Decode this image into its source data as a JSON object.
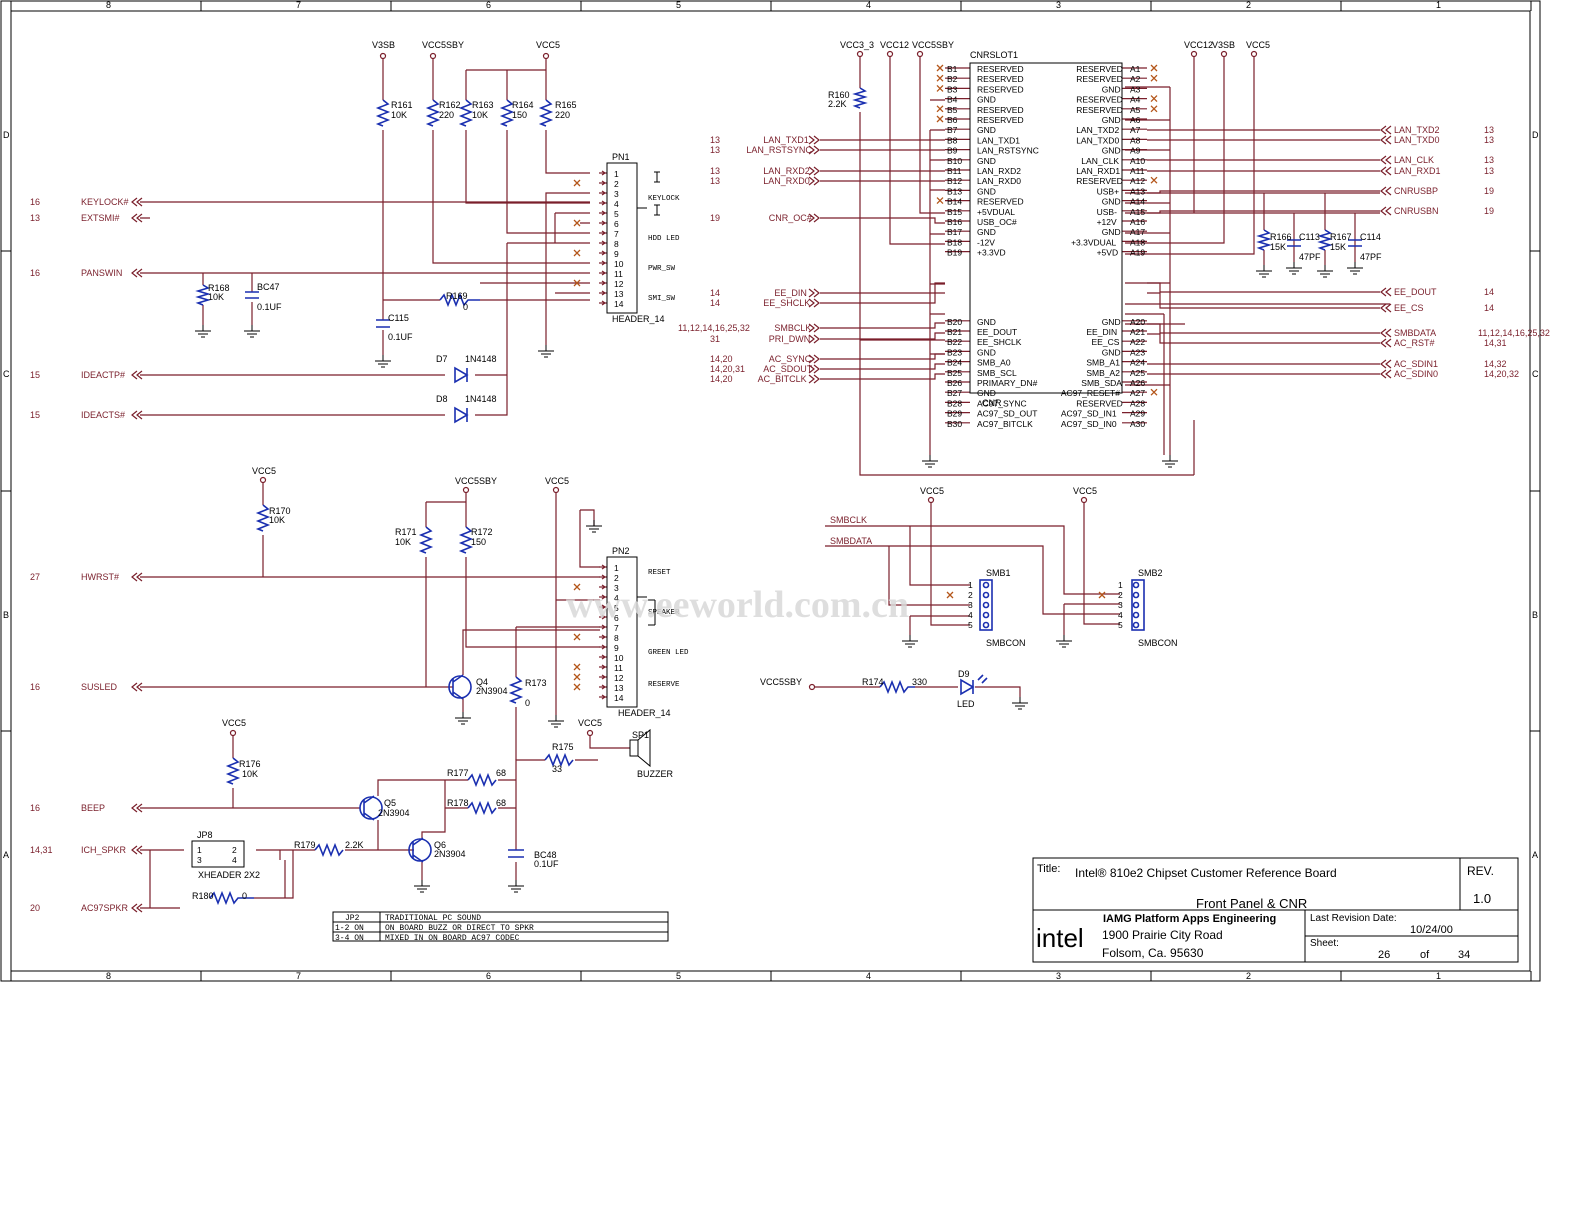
{
  "border": {
    "columns": [
      "8",
      "7",
      "6",
      "5",
      "4",
      "3",
      "2",
      "1"
    ],
    "rows": [
      "D",
      "C",
      "B",
      "A"
    ]
  },
  "supplies": {
    "v3sb": "V3SB",
    "vcc5sby": "VCC5SBY",
    "vcc5": "VCC5",
    "vcc3_3": "VCC3_3",
    "vcc12": "VCC12",
    "v3sb2": "V3SB"
  },
  "front_panel": {
    "pn1": {
      "ref": "PN1",
      "type": "HEADER_14",
      "pins": [
        "1",
        "2",
        "3",
        "4",
        "5",
        "6",
        "7",
        "8",
        "9",
        "10",
        "11",
        "12",
        "13",
        "14"
      ],
      "groups": [
        "KEYLOCK",
        "HDD LED",
        "PWR_SW",
        "SMI_SW"
      ]
    },
    "pn2": {
      "ref": "PN2",
      "type": "HEADER_14",
      "pins": [
        "1",
        "2",
        "3",
        "4",
        "5",
        "6",
        "7",
        "8",
        "9",
        "10",
        "11",
        "12",
        "13",
        "14"
      ],
      "groups": [
        "RESET",
        "SPEAKER",
        "GREEN LED",
        "RESERVE"
      ]
    },
    "signals": [
      {
        "page": "16",
        "name": "KEYLOCK#"
      },
      {
        "page": "13",
        "name": "EXTSMI#"
      },
      {
        "page": "16",
        "name": "PANSWIN"
      },
      {
        "page": "15",
        "name": "IDEACTP#"
      },
      {
        "page": "15",
        "name": "IDEACTS#"
      },
      {
        "page": "27",
        "name": "HWRST#"
      },
      {
        "page": "16",
        "name": "SUSLED"
      },
      {
        "page": "16",
        "name": "BEEP"
      },
      {
        "page": "14,31",
        "name": "ICH_SPKR"
      },
      {
        "page": "20",
        "name": "AC97SPKR"
      }
    ],
    "resistors": [
      {
        "ref": "R161",
        "value": "10K"
      },
      {
        "ref": "R162",
        "value": "220"
      },
      {
        "ref": "R163",
        "value": "10K"
      },
      {
        "ref": "R164",
        "value": "150"
      },
      {
        "ref": "R165",
        "value": "220"
      },
      {
        "ref": "R168",
        "value": "10K"
      },
      {
        "ref": "R169",
        "value": "0"
      },
      {
        "ref": "R170",
        "value": "10K"
      },
      {
        "ref": "R171",
        "value": "10K"
      },
      {
        "ref": "R172",
        "value": "150"
      },
      {
        "ref": "R173",
        "value": "0"
      },
      {
        "ref": "R175",
        "value": "33"
      },
      {
        "ref": "R176",
        "value": "10K"
      },
      {
        "ref": "R177",
        "value": "68"
      },
      {
        "ref": "R178",
        "value": "68"
      },
      {
        "ref": "R179",
        "value": "2.2K"
      },
      {
        "ref": "R180",
        "value": "0"
      },
      {
        "ref": "R174",
        "value": "330"
      }
    ],
    "caps": [
      {
        "ref": "BC47",
        "value": "0.1UF"
      },
      {
        "ref": "C115",
        "value": "0.1UF"
      },
      {
        "ref": "BC48",
        "value": "0.1UF"
      }
    ],
    "diodes": [
      {
        "ref": "D7",
        "value": "1N4148"
      },
      {
        "ref": "D8",
        "value": "1N4148"
      }
    ],
    "transistors": [
      {
        "ref": "Q4",
        "value": "2N3904"
      },
      {
        "ref": "Q5",
        "value": "2N3904"
      },
      {
        "ref": "Q6",
        "value": "2N3904"
      }
    ],
    "jp8": {
      "ref": "JP8",
      "type": "XHEADER 2X2",
      "pins": [
        "1",
        "2",
        "3",
        "4"
      ]
    },
    "speaker": {
      "ref": "SP1",
      "type": "BUZZER"
    },
    "led": {
      "ref": "D9",
      "type": "LED"
    }
  },
  "jp2_table": [
    [
      "JP2",
      "TRADITIONAL PC SOUND"
    ],
    [
      "1-2 ON",
      "ON BOARD BUZZ OR DIRECT TO SPKR"
    ],
    [
      "3-4 ON",
      "MIXED IN ON BOARD AC97 CODEC"
    ]
  ],
  "cnr": {
    "ref": "CNRSLOT1",
    "footer": "CNR",
    "r160": {
      "ref": "R160",
      "value": "2.2K"
    },
    "b_pins": [
      "B1",
      "B2",
      "B3",
      "B4",
      "B5",
      "B6",
      "B7",
      "B8",
      "B9",
      "B10",
      "B11",
      "B12",
      "B13",
      "B14",
      "B15",
      "B16",
      "B17",
      "B18",
      "B19",
      "B20",
      "B21",
      "B22",
      "B23",
      "B24",
      "B25",
      "B26",
      "B27",
      "B28",
      "B29",
      "B30"
    ],
    "b_names": [
      "RESERVED",
      "RESERVED",
      "RESERVED",
      "GND",
      "RESERVED",
      "RESERVED",
      "GND",
      "LAN_TXD1",
      "LAN_RSTSYNC",
      "GND",
      "LAN_RXD2",
      "LAN_RXD0",
      "GND",
      "RESERVED",
      "+5VDUAL",
      "USB_OC#",
      "GND",
      "-12V",
      "+3.3VD",
      "GND",
      "EE_DOUT",
      "EE_SHCLK",
      "GND",
      "SMB_A0",
      "SMB_SCL",
      "PRIMARY_DN#",
      "GND",
      "AC97_SYNC",
      "AC97_SD_OUT",
      "AC97_BITCLK"
    ],
    "a_pins": [
      "A1",
      "A2",
      "A3",
      "A4",
      "A5",
      "A6",
      "A7",
      "A8",
      "A9",
      "A10",
      "A11",
      "A12",
      "A13",
      "A14",
      "A15",
      "A16",
      "A17",
      "A18",
      "A19",
      "A20",
      "A21",
      "A22",
      "A23",
      "A24",
      "A25",
      "A26",
      "A27",
      "A28",
      "A29",
      "A30"
    ],
    "a_names": [
      "RESERVED",
      "RESERVED",
      "GND",
      "RESERVED",
      "RESERVED",
      "GND",
      "LAN_TXD2",
      "LAN_TXD0",
      "GND",
      "LAN_CLK",
      "LAN_RXD1",
      "RESERVED",
      "USB+",
      "GND",
      "USB-",
      "+12V",
      "GND",
      "+3.3VDUAL",
      "+5VD",
      "GND",
      "EE_DIN",
      "EE_CS",
      "GND",
      "SMB_A1",
      "SMB_A2",
      "SMB_SDA",
      "AC97_RESET#",
      "RESERVED",
      "AC97_SD_IN1",
      "AC97_SD_IN0"
    ],
    "left_signals": [
      {
        "page": "13",
        "name": "LAN_TXD1"
      },
      {
        "page": "13",
        "name": "LAN_RSTSYNC"
      },
      {
        "page": "13",
        "name": "LAN_RXD2"
      },
      {
        "page": "13",
        "name": "LAN_RXD0"
      },
      {
        "page": "19",
        "name": "CNR_OC#"
      },
      {
        "page": "14",
        "name": "EE_DIN"
      },
      {
        "page": "14",
        "name": "EE_SHCLK"
      },
      {
        "page": "11,12,14,16,25,32",
        "name": "SMBCLK"
      },
      {
        "page": "31",
        "name": "PRI_DWN"
      },
      {
        "page": "14,20",
        "name": "AC_SYNC"
      },
      {
        "page": "14,20,31",
        "name": "AC_SDOUT"
      },
      {
        "page": "14,20",
        "name": "AC_BITCLK"
      }
    ],
    "right_signals": [
      {
        "page": "13",
        "name": "LAN_TXD2"
      },
      {
        "page": "13",
        "name": "LAN_TXD0"
      },
      {
        "page": "13",
        "name": "LAN_CLK"
      },
      {
        "page": "13",
        "name": "LAN_RXD1"
      },
      {
        "page": "19",
        "name": "CNRUSBP"
      },
      {
        "page": "19",
        "name": "CNRUSBN"
      },
      {
        "page": "14",
        "name": "EE_DOUT"
      },
      {
        "page": "14",
        "name": "EE_CS"
      },
      {
        "page": "11,12,14,16,25,32",
        "name": "SMBDATA"
      },
      {
        "page": "14,31",
        "name": "AC_RST#"
      },
      {
        "page": "14,32",
        "name": "AC_SDIN1"
      },
      {
        "page": "14,20,32",
        "name": "AC_SDIN0"
      }
    ],
    "usb_parts": [
      {
        "ref": "R166",
        "value": "15K"
      },
      {
        "ref": "C113",
        "value": "47PF"
      },
      {
        "ref": "R167",
        "value": "15K"
      },
      {
        "ref": "C114",
        "value": "47PF"
      }
    ]
  },
  "smbus": {
    "signals": [
      "SMBCLK",
      "SMBDATA"
    ],
    "smb1": {
      "ref": "SMB1",
      "type": "SMBCON",
      "pins": [
        "1",
        "2",
        "3",
        "4",
        "5"
      ]
    },
    "smb2": {
      "ref": "SMB2",
      "type": "SMBCON",
      "pins": [
        "1",
        "2",
        "3",
        "4",
        "5"
      ]
    }
  },
  "watermark": "www.eeworld.com.cn",
  "title_block": {
    "title_label": "Title:",
    "title": "Intel® 810e2 Chipset Customer Reference Board",
    "subtitle": "Front Panel & CNR",
    "rev_label": "REV.",
    "rev": "1.0",
    "logo": "intel",
    "org": "IAMG Platform Apps Engineering",
    "addr1": "1900 Prairie City Road",
    "addr2": "Folsom, Ca. 95630",
    "last_rev_label": "Last Revision Date:",
    "last_rev": "10/24/00",
    "sheet_label": "Sheet:",
    "sheet": "26",
    "of": "of",
    "total": "34"
  },
  "colors": {
    "wire": "#7a1f2b",
    "component": "#1a2fb0",
    "noconnect": "#b4561a",
    "ink": "#000000"
  }
}
